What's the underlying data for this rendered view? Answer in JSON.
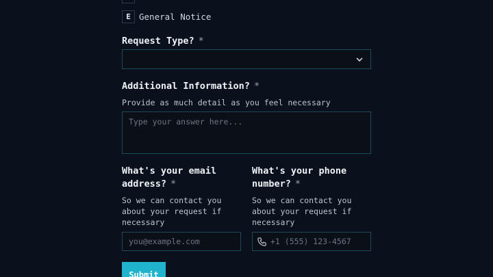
{
  "options": [
    {
      "key": "E",
      "label": "General Notice"
    }
  ],
  "request_type": {
    "title": "Request Type?",
    "required_mark": "*",
    "value": ""
  },
  "additional_info": {
    "title": "Additional Information?",
    "required_mark": "*",
    "description": "Provide as much detail as you feel necessary",
    "placeholder": "Type your answer here..."
  },
  "email": {
    "title_line1": "What's your email",
    "title_line2": "address?",
    "required_mark": "*",
    "desc_line1": "So we can contact you",
    "desc_line2": "about your request if",
    "desc_line3": "necessary",
    "placeholder": "you@example.com"
  },
  "phone": {
    "title_line1": "What's your phone",
    "title_line2": "number?",
    "required_mark": "*",
    "desc_line1": "So we can contact you",
    "desc_line2": "about your request if",
    "desc_line3": "necessary",
    "placeholder": "+1 (555) 123-4567"
  },
  "submit": {
    "label": "Submit"
  },
  "colors": {
    "background": "#0b111c",
    "border": "#1d4c58",
    "accent": "#1fb3cc"
  },
  "icons": {
    "select": "chevron-down-icon",
    "phone": "phone-icon"
  }
}
